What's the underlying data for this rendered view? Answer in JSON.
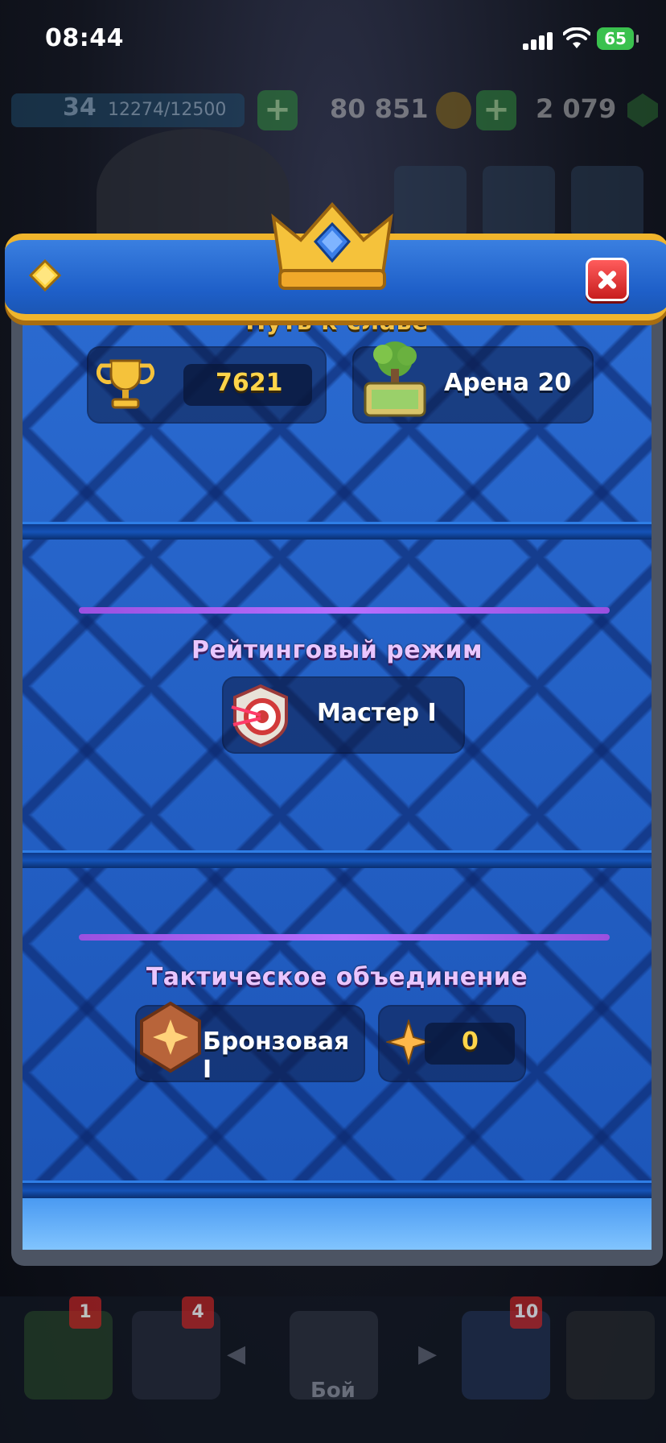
{
  "status_bar": {
    "time": "08:44",
    "battery": "65"
  },
  "top_bar": {
    "level": "34",
    "xp": "12274/12500",
    "gold": "80 851",
    "gems": "2 079"
  },
  "modal": {
    "sections": {
      "path_of_glory": {
        "title": "Путь к славе",
        "trophies": "7621",
        "arena": "Арена 20"
      },
      "ranked": {
        "title": "Рейтинговый режим",
        "league": "Мастер I"
      },
      "tactical": {
        "title": "Тактическое объединение",
        "league": "Бронзовая I",
        "points": "0"
      }
    }
  },
  "bottom_nav": {
    "badges": [
      "1",
      "4",
      "10"
    ],
    "battle_label": "Бой"
  },
  "colors": {
    "header_blue": "#1e5fc8",
    "gold_trim": "#f0b52c",
    "purple_accent": "#b770ff",
    "close_red": "#c81e1e"
  }
}
